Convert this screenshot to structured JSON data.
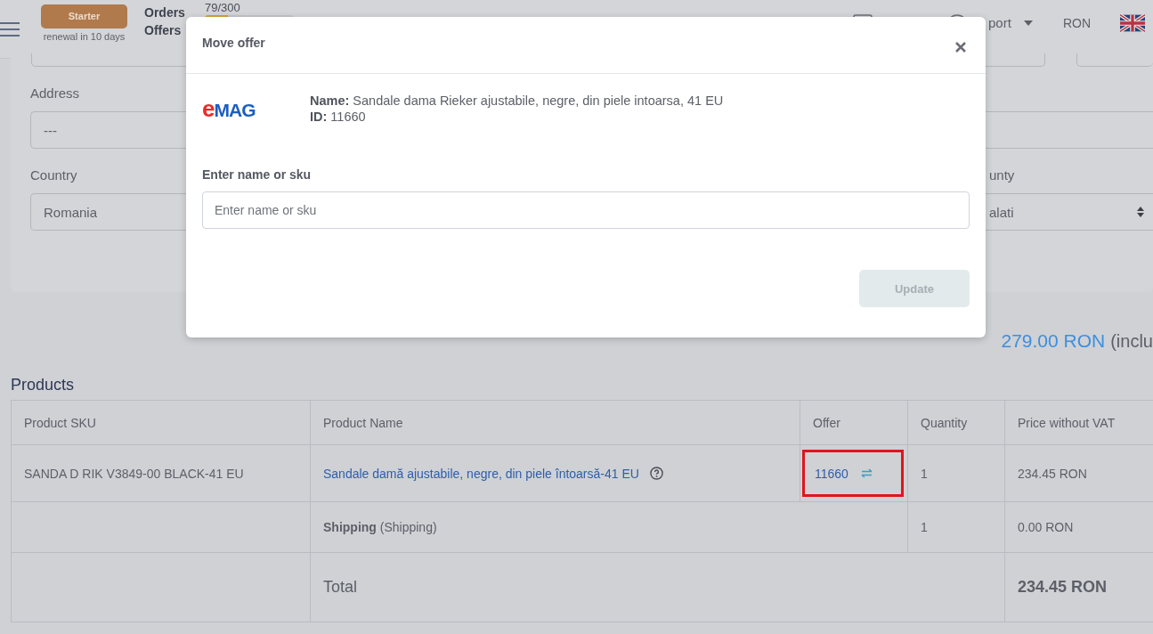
{
  "header": {
    "plan": "Starter",
    "renewal": "renewal in 10 days",
    "counters": [
      {
        "label": "Orders"
      },
      {
        "label": "Offers"
      }
    ],
    "usage": {
      "reading": "79/300",
      "level": 0.26
    },
    "support": "port",
    "currency": "RON"
  },
  "form": {
    "address": {
      "label": "Address",
      "value": "---"
    },
    "country": {
      "label": "Country",
      "value": "Romania"
    },
    "county": {
      "label": "unty",
      "value": "alati"
    }
  },
  "order_total": {
    "amount": "279.00 RON",
    "note": "(inclu"
  },
  "products": {
    "title": "Products",
    "columns": [
      "Product SKU",
      "Product Name",
      "Offer",
      "Quantity",
      "Price without VAT"
    ],
    "rows": [
      {
        "kind": "item",
        "sku": "SANDA D RIK V3849-00 BLACK-41 EU",
        "name": "Sandale damă ajustabile, negre, din piele întoarsă-41 EU",
        "offer": "11660",
        "highlighted": true,
        "quantity": "1",
        "price": "234.45 RON"
      },
      {
        "kind": "shipping",
        "label": "Shipping",
        "note": "(Shipping)",
        "quantity": "1",
        "price": "0.00 RON"
      },
      {
        "kind": "total",
        "label": "Total",
        "price": "234.45 RON"
      }
    ]
  },
  "modal": {
    "title": "Move offer",
    "logo": {
      "first": "e",
      "rest": "MAG"
    },
    "name_label": "Name:",
    "name": "Sandale dama Rieker ajustabile, negre, din piele intoarsa, 41 EU",
    "id_label": "ID:",
    "id": "11660",
    "search_label": "Enter name or sku",
    "search": {
      "placeholder": "Enter name or sku"
    },
    "update": {
      "label": "Update",
      "disabled": true
    }
  }
}
